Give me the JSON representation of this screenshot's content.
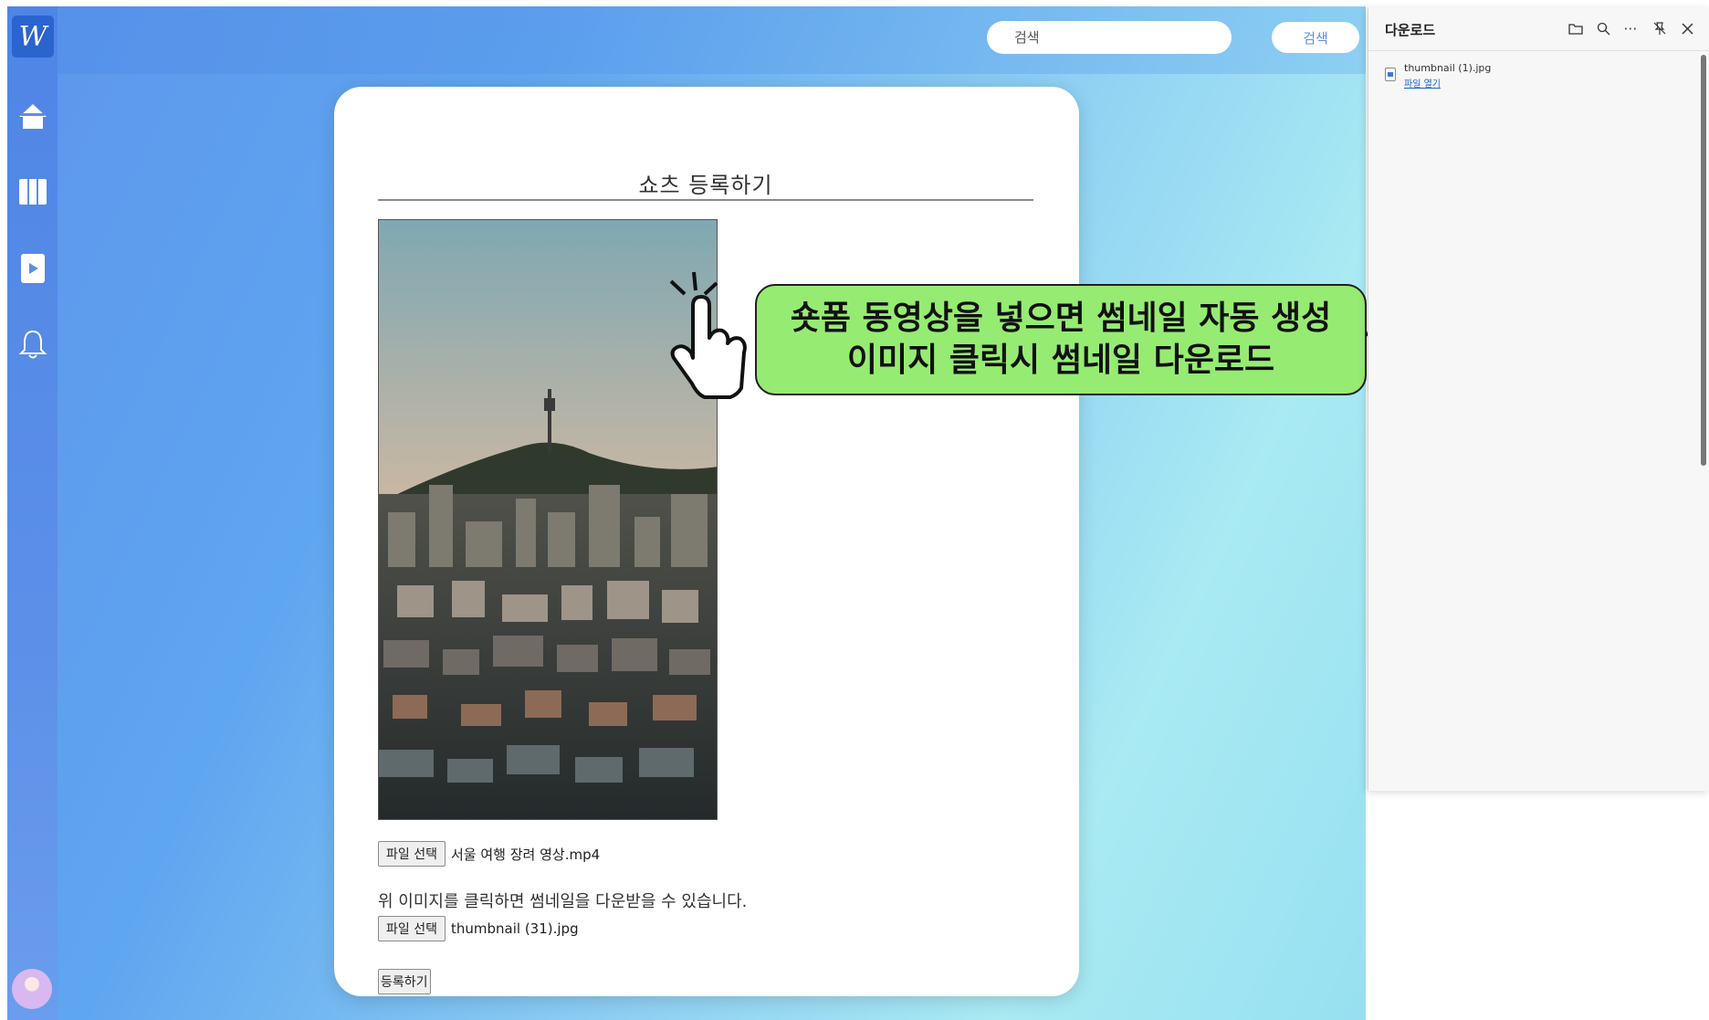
{
  "app": {
    "logo_letter": "W"
  },
  "sidebar": {
    "items": [
      {
        "name": "home",
        "icon": "home-icon"
      },
      {
        "name": "map",
        "icon": "map-icon"
      },
      {
        "name": "shorts",
        "icon": "play-icon"
      },
      {
        "name": "notifications",
        "icon": "bell-icon"
      }
    ]
  },
  "search": {
    "placeholder": "검색",
    "button_label": "검색"
  },
  "form": {
    "title": "쇼츠 등록하기",
    "video_file": {
      "button_label": "파일 선택",
      "file_name": "서울 여행 장려 영상.mp4"
    },
    "hint": "위 이미지를 클릭하면 썸네일을 다운받을 수 있습니다.",
    "thumbnail_file": {
      "button_label": "파일 선택",
      "file_name": "thumbnail (31).jpg"
    },
    "submit_label": "등록하기"
  },
  "annotation": {
    "line1": "숏폼 동영상을 넣으면 썸네일 자동 생성",
    "line2": "이미지 클릭시 썸네일 다운로드",
    "color": "#96ec72"
  },
  "downloads": {
    "title": "다운로드",
    "item": {
      "file_name": "thumbnail (1).jpg",
      "action_label": "파일 열기"
    }
  },
  "colors": {
    "sidebar": "#5b8fe8",
    "logo_bg": "#2a64cf",
    "link": "#1a5fd0"
  }
}
